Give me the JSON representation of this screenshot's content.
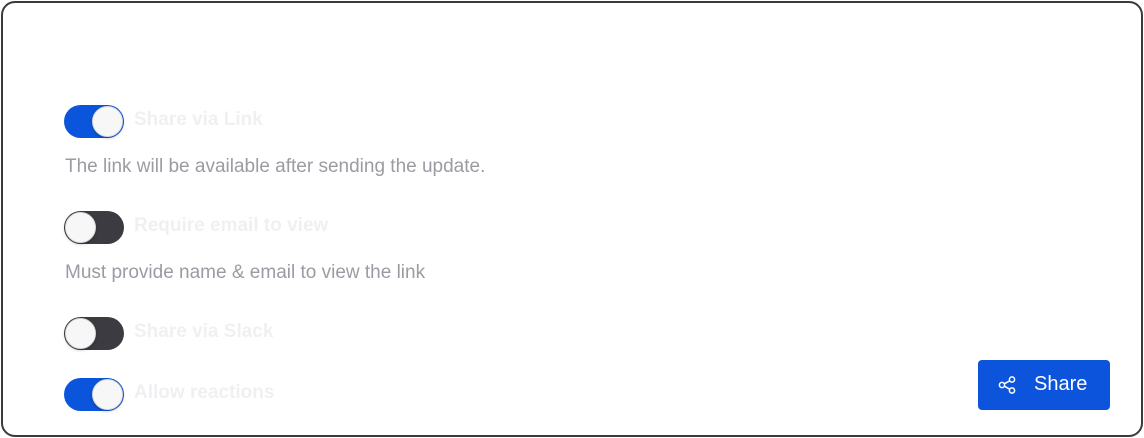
{
  "toggles": [
    {
      "label": "Share via Link",
      "state": "on",
      "description": "The link will be available after sending the update."
    },
    {
      "label": "Require email to view",
      "state": "off",
      "description": "Must provide name & email to view the link"
    },
    {
      "label": "Share via Slack",
      "state": "off"
    },
    {
      "label": "Allow reactions",
      "state": "on"
    }
  ],
  "share_button": {
    "label": "Share",
    "icon": "share-icon"
  },
  "colors": {
    "accent": "#0b55dc",
    "toggle_off": "#3b3b41",
    "description_text": "#9b9ba3",
    "border": "#3a3a3f"
  }
}
